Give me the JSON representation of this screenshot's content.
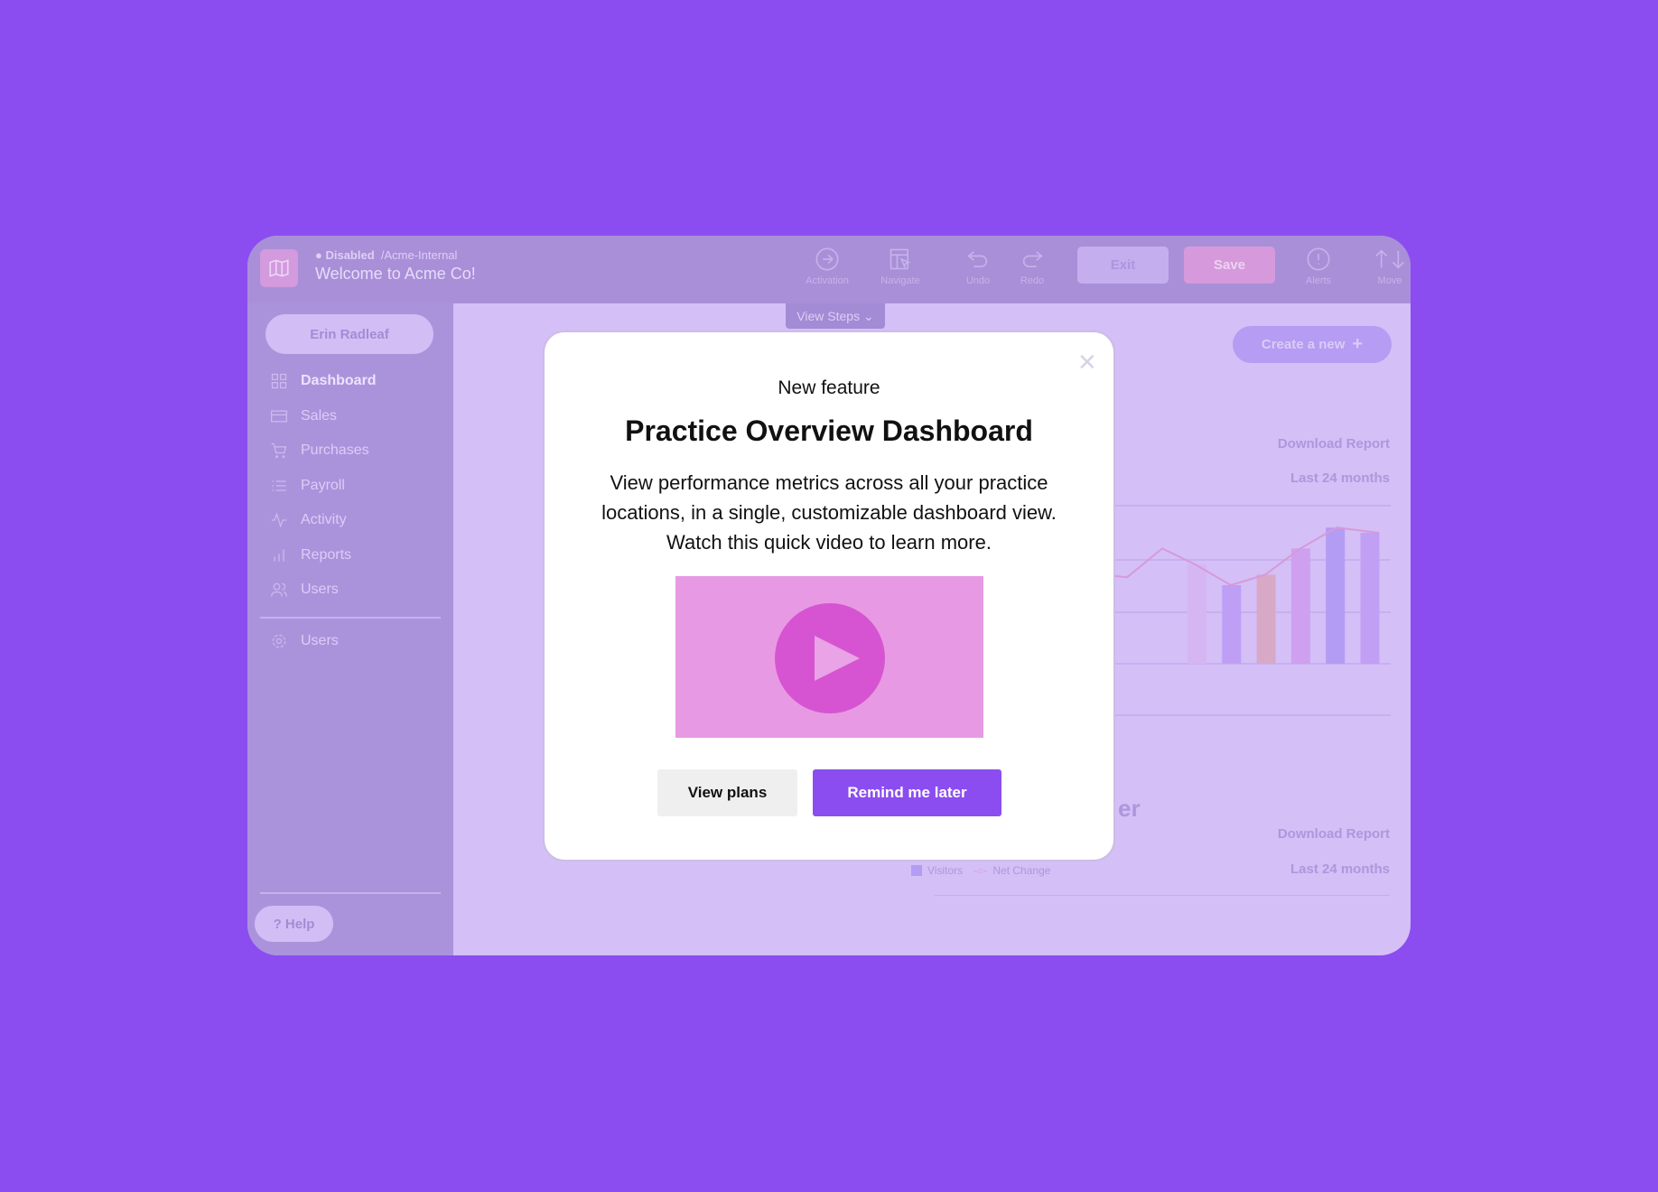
{
  "header": {
    "status": "Disabled",
    "workspace": "/Acme-Internal",
    "title": "Welcome to Acme Co!",
    "tools": [
      {
        "label": "Activation",
        "icon": "arrow-right-circle-icon"
      },
      {
        "label": "Navigate",
        "icon": "navigate-icon"
      },
      {
        "label": "Undo",
        "icon": "undo-icon"
      },
      {
        "label": "Redo",
        "icon": "redo-icon"
      }
    ],
    "exit_label": "Exit",
    "save_label": "Save",
    "alerts_label": "Alerts",
    "move_label": "Move",
    "view_steps": "View Steps"
  },
  "sidebar": {
    "user": "Erin Radleaf",
    "items": [
      {
        "label": "Dashboard",
        "icon": "grid-icon"
      },
      {
        "label": "Sales",
        "icon": "card-icon"
      },
      {
        "label": "Purchases",
        "icon": "cart-icon"
      },
      {
        "label": "Payroll",
        "icon": "list-icon"
      },
      {
        "label": "Activity",
        "icon": "activity-icon"
      },
      {
        "label": "Reports",
        "icon": "bar-chart-icon"
      },
      {
        "label": "Users",
        "icon": "users-icon"
      }
    ],
    "settings_item": {
      "label": "Users",
      "icon": "gear-icon"
    },
    "help": "? Help"
  },
  "main": {
    "create_label": "Create a new",
    "section1": {
      "download": "Download Report",
      "period": "Last 24 months"
    },
    "section2": {
      "title_fragment": "er",
      "download": "Download Report",
      "period": "Last 24 months",
      "legend": [
        "Visitors",
        "Net Change"
      ]
    }
  },
  "chart_data": {
    "type": "bar",
    "bars": [
      1.9,
      1.5,
      1.7,
      2.2,
      2.6,
      2.5
    ],
    "bar_colors": [
      "#d5b6f3",
      "#bf9ef5",
      "#d7a9c6",
      "#cfa0ef",
      "#b39cf3",
      "#c09ff5"
    ],
    "line": [
      1.7,
      1.65,
      2.2,
      1.9,
      1.5,
      1.7,
      2.2,
      2.6,
      2.5
    ],
    "line_color": "#d79ad8",
    "grid": true
  },
  "modal": {
    "eyebrow": "New feature",
    "title": "Practice Overview Dashboard",
    "body": [
      "View performance metrics across all your practice",
      "locations, in a single, customizable dashboard view.",
      "Watch this quick video to learn more."
    ],
    "secondary": "View plans",
    "primary": "Remind me later"
  },
  "colors": {
    "background": "#8b4def",
    "primary": "#8b4def",
    "play": "#d654d1"
  }
}
